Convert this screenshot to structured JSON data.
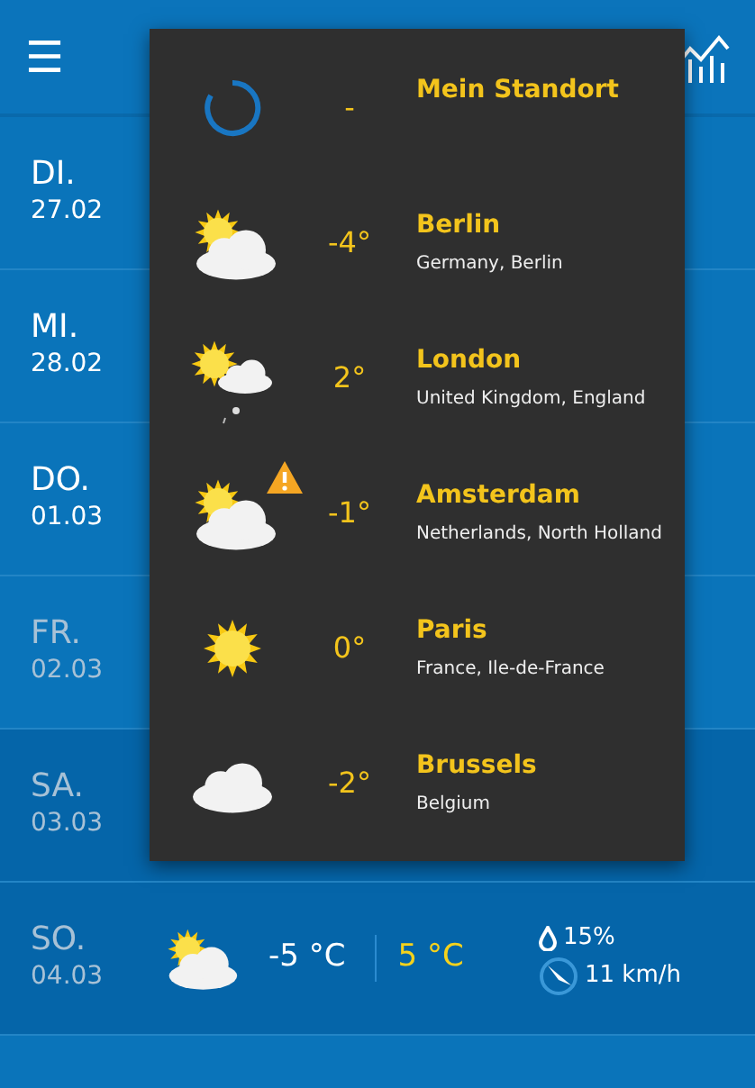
{
  "toolbar": {
    "menu": "☰"
  },
  "days": [
    {
      "day": "DI.",
      "date": "27.02",
      "muted": false,
      "dark": false
    },
    {
      "day": "MI.",
      "date": "28.02",
      "muted": false,
      "dark": false
    },
    {
      "day": "DO.",
      "date": "01.03",
      "muted": false,
      "dark": false
    },
    {
      "day": "FR.",
      "date": "02.03",
      "muted": true,
      "dark": false
    },
    {
      "day": "SA.",
      "date": "03.03",
      "muted": true,
      "dark": true
    },
    {
      "day": "SO.",
      "date": "04.03",
      "muted": true,
      "dark": true,
      "kind": "partly-cloudy",
      "low": "-5 °C",
      "high": "5 °C",
      "rain": "15%",
      "wind": "11 km/h"
    }
  ],
  "locations": [
    {
      "kind": "loading",
      "temp": "-",
      "name": "Mein Standort",
      "warning": false
    },
    {
      "kind": "partly-cloudy",
      "temp": "-4°",
      "name": "Berlin",
      "region": "Germany, Berlin",
      "warning": false
    },
    {
      "kind": "sun-rain",
      "temp": "2°",
      "name": "London",
      "region": "United Kingdom, England",
      "warning": false
    },
    {
      "kind": "partly-cloudy",
      "temp": "-1°",
      "name": "Amsterdam",
      "region": "Netherlands, North Holland",
      "warning": true
    },
    {
      "kind": "sun",
      "temp": "0°",
      "name": "Paris",
      "region": "France, Ile-de-France",
      "warning": false
    },
    {
      "kind": "cloud",
      "temp": "-2°",
      "name": "Brussels",
      "region": "Belgium",
      "warning": false
    }
  ]
}
